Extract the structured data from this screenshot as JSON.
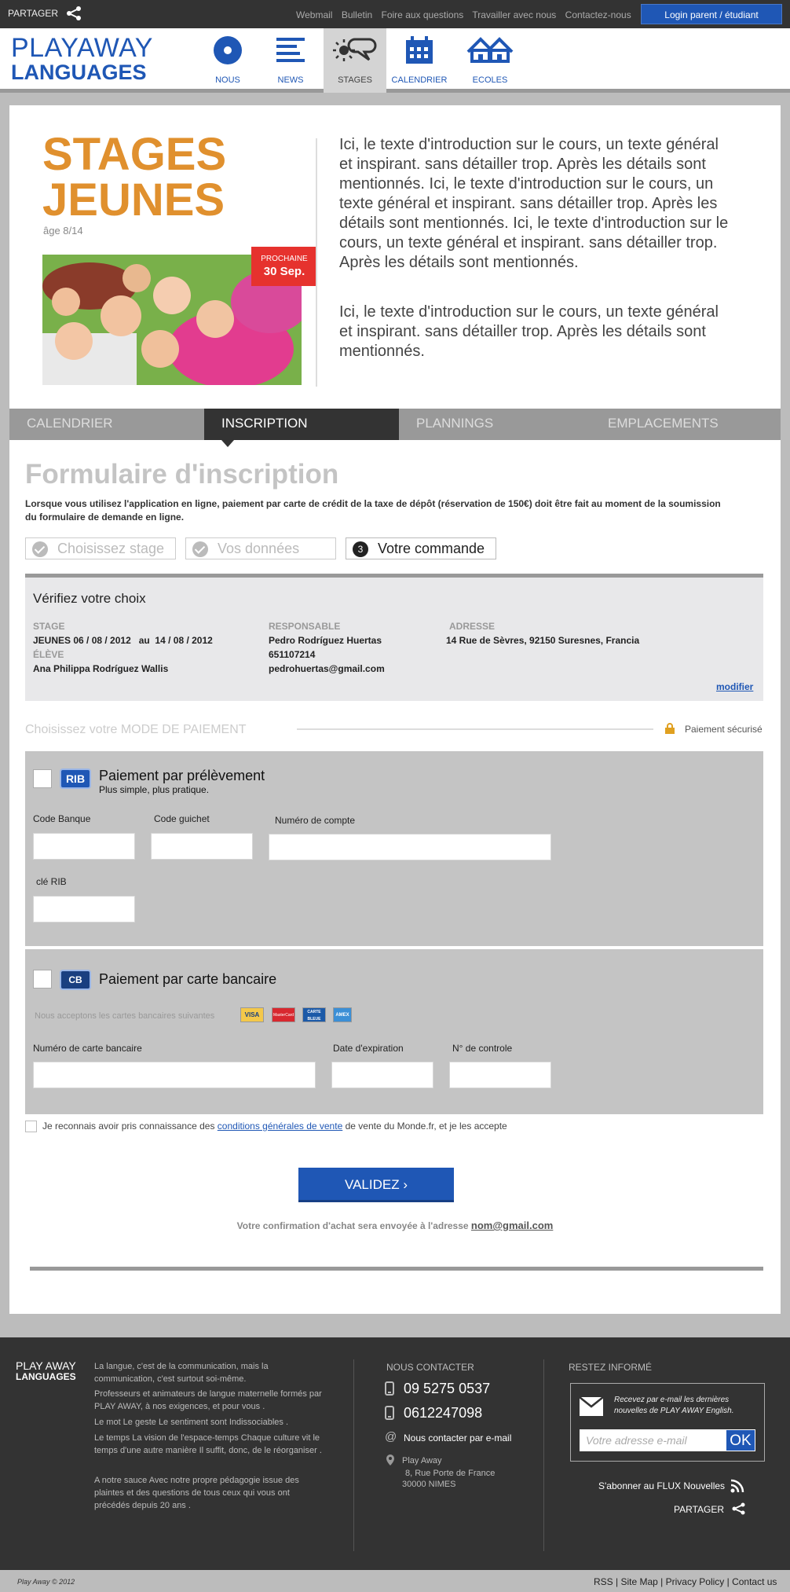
{
  "topbar": {
    "share_label": "PARTAGER",
    "links": [
      "Webmail",
      "Bulletin",
      "Foire aux questions",
      "Travailler avec nous",
      "Contactez-nous"
    ],
    "login_label": "Login parent / étudiant"
  },
  "brand": {
    "line1": "PLAYAWAY",
    "line2": "LANGUAGES"
  },
  "nav": [
    {
      "label": "NOUS",
      "icon": "circle-dot-icon"
    },
    {
      "label": "NEWS",
      "icon": "news-lines-icon"
    },
    {
      "label": "STAGES",
      "icon": "sun-speech-icon",
      "active": true
    },
    {
      "label": "CALENDRIER",
      "icon": "calendar-icon"
    },
    {
      "label": "ECOLES",
      "icon": "houses-icon"
    }
  ],
  "hero": {
    "title1": "STAGES",
    "title2": "JEUNES",
    "age": "âge 8/14",
    "badge_label": "PROCHAINE",
    "badge_date": "30 Sep.",
    "intro1": "Ici, le texte d'introduction sur le cours, un texte général et inspirant. sans détailler trop. Après les détails sont mentionnés. Ici, le texte d'introduction sur le cours, un texte général et inspirant. sans détailler trop. Après les détails sont mentionnés. Ici, le texte d'introduction sur le cours, un texte général et inspirant. sans détailler trop. Après les détails sont mentionnés.",
    "intro2": "Ici, le texte d'introduction sur le cours, un texte général et inspirant. sans détailler trop. Après les détails sont mentionnés."
  },
  "tabs": [
    "CALENDRIER",
    "INSCRIPTION",
    "PLANNINGS",
    "EMPLACEMENTS"
  ],
  "form": {
    "title": "Formulaire d'inscription",
    "desc_before": "Lorsque vous utilisez l'application en ligne, paiement par carte de crédit de la taxe de dépôt (",
    "desc_bold": "réservation de 150€)",
    "desc_after": " doit être fait au moment de la soumission du formulaire de demande en ligne.",
    "steps": [
      "Choisissez stage",
      "Vos données",
      "Votre commande"
    ],
    "step3_num": "3"
  },
  "verify": {
    "title": "Vérifiez votre choix",
    "stage_label": "STAGE",
    "stage_value": "JEUNES 06 / 08 / 2012   au  14 / 08 / 2012",
    "eleve_label": "ÉLÈVE",
    "eleve_value": "Ana Philippa Rodríguez Wallis",
    "resp_label": "RESPONSABLE",
    "resp_name": "Pedro Rodríguez Huertas",
    "resp_phone": "651107214",
    "resp_email": "pedrohuertas@gmail.com",
    "addr_label": "ADRESSE",
    "addr_value": "14 Rue de Sèvres, 92150 Suresnes, Francia",
    "modifier": "modifier"
  },
  "payment": {
    "title": "Choisissez votre MODE DE PAIEMENT",
    "secure": "Paiement sécurisé",
    "rib": {
      "logo": "RIB",
      "title": "Paiement par prélèvement",
      "subtitle": "Plus simple, plus pratique.",
      "code_banque": "Code Banque",
      "code_guichet": "Code guichet",
      "numero_compte": "Numéro de compte",
      "cle_rib": "clé RIB"
    },
    "cb": {
      "logo": "CB",
      "title": "Paiement par carte bancaire",
      "accept": "Nous acceptons les cartes bancaires suivantes",
      "cards": [
        "VISA",
        "MasterCard",
        "CARTE BLEUE",
        "AMEX"
      ],
      "numero_carte": "Numéro de carte bancaire",
      "date_exp": "Date d'expiration",
      "controle": "N° de controle"
    }
  },
  "cgv": {
    "before": "Je reconnais avoir pris connaissance des ",
    "link": "conditions générales de vente",
    "after": " de vente du Monde.fr, et je les accepte"
  },
  "submit": {
    "label": "VALIDEZ  ›",
    "confirm": "Votre confirmation d'achat sera envoyée à l'adresse ",
    "email": "nom@gmail.com"
  },
  "footer": {
    "logo1": "PLAY AWAY",
    "logo2": "LANGUAGES",
    "paras": [
      "La langue, c'est de la communication, mais la communication, c'est surtout soi-même.",
      "Professeurs et animateurs de langue maternelle formés par PLAY AWAY, à nos exigences, et pour vous .",
      "Le mot Le geste Le sentiment sont Indissociables .",
      "Le temps La vision de l'espace-temps Chaque culture vit le temps d'une autre manière Il suffit, donc, de le réorganiser .",
      "A notre sauce Avec notre propre pédagogie issue des plaintes et des questions de tous ceux qui vous ont précédés depuis 20 ans ."
    ],
    "contact_title": "NOUS CONTACTER",
    "phone1": "09 5275 0537",
    "phone2": "0612247098",
    "email_label": "Nous contacter par e-mail",
    "addr1": "Play Away",
    "addr2": "8, Rue Porte de France",
    "addr3": "30000 NIMES",
    "info_title": "RESTEZ INFORMÉ",
    "news_text1": "Recevez par e-mail les dernières",
    "news_text2": "nouvelles de PLAY AWAY English.",
    "news_placeholder": "Votre adresse e-mail",
    "news_ok": "OK",
    "subscribe": "S'abonner au FLUX Nouvelles",
    "share": "PARTAGER"
  },
  "bottom": {
    "copyright": "Play Away © 2012",
    "links": "RSS | Site Map | Privacy Policy | Contact us"
  },
  "colors": {
    "brand_blue": "#1f57b5",
    "orange": "#e0902e",
    "badge_red": "#e6322e",
    "dark": "#333333"
  }
}
